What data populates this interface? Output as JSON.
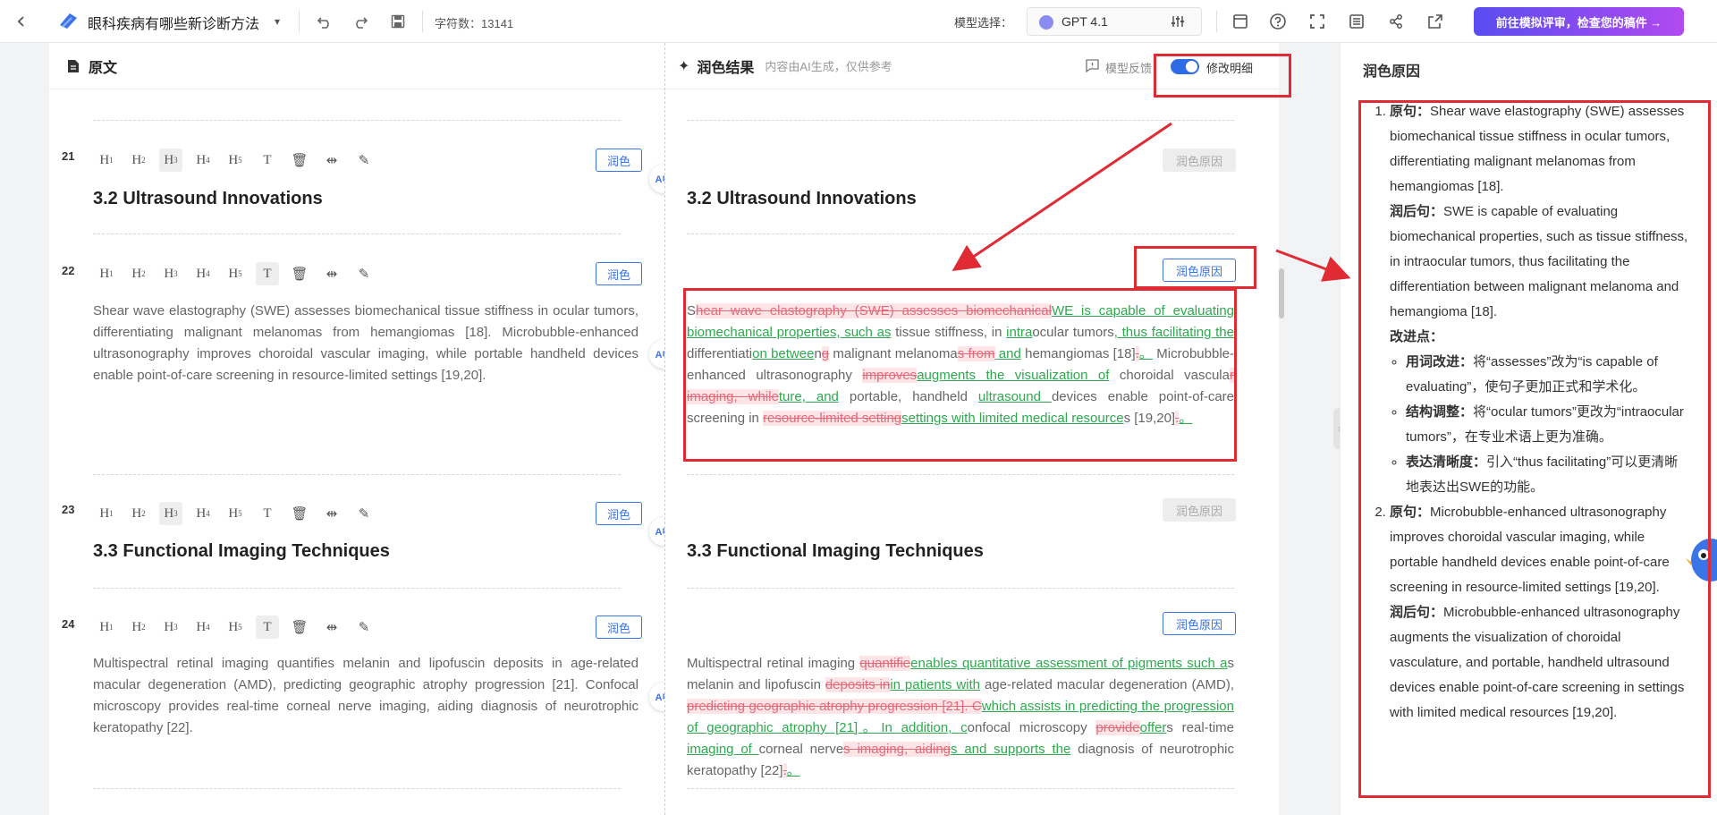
{
  "topbar": {
    "doc_title": "眼科疾病有哪些新诊断方法",
    "char_count": "字符数：13141",
    "model_label": "模型选择：",
    "model_name": "GPT 4.1",
    "cta": "前往模拟评审，检查您的稿件 →"
  },
  "left": {
    "header": "原文"
  },
  "right": {
    "header": "润色结果",
    "subheader": "内容由AI生成，仅供参考",
    "feedback": "模型反馈",
    "toggle_label": "修改明细"
  },
  "buttons": {
    "polish": "润色",
    "reason": "润色原因"
  },
  "sections": {
    "r21": {
      "num": "21",
      "title": "3.2 Ultrasound Innovations"
    },
    "r22": {
      "num": "22",
      "orig": "Shear wave elastography (SWE) assesses biomechanical tissue stiffness in ocular tumors, differentiating malignant melanomas from hemangiomas [18]. Microbubble-enhanced ultrasonography improves choroidal vascular imaging, while portable handheld devices enable point-of-care screening in resource-limited settings [19,20]."
    },
    "r23": {
      "num": "23",
      "title": "3.3 Functional Imaging Techniques"
    },
    "r24": {
      "num": "24",
      "orig": "Multispectral retinal imaging quantifies melanin and lipofuscin deposits in age-related macular degeneration (AMD), predicting geographic atrophy progression [21]. Confocal microscopy provides real-time corneal nerve imaging, aiding diagnosis of neurotrophic keratopathy [22]."
    }
  },
  "diff22": [
    [
      "n",
      "S"
    ],
    [
      "d",
      "hear wave elastography (SWE) assesses biomechanical"
    ],
    [
      "i",
      "WE is capable of evaluating biomechanical properties, such as"
    ],
    [
      "n",
      " tissue stiffness, in "
    ],
    [
      "i",
      "intra"
    ],
    [
      "n",
      "ocular tumors"
    ],
    [
      "i",
      ", thus facilitating the"
    ],
    [
      "n",
      " differentiati"
    ],
    [
      "i",
      "on betwee"
    ],
    [
      "n",
      "n"
    ],
    [
      "d",
      "g"
    ],
    [
      "n",
      " malignant melanoma"
    ],
    [
      "d",
      "s from"
    ],
    [
      "i",
      " and"
    ],
    [
      "n",
      " hemangiomas [18]"
    ],
    [
      "d",
      "."
    ],
    [
      "i",
      "。"
    ],
    [
      "n",
      " Microbubble-enhanced ultrasonography "
    ],
    [
      "d",
      "improves"
    ],
    [
      "i",
      "augments the visualization of"
    ],
    [
      "n",
      " choroidal vascula"
    ],
    [
      "d",
      "r imaging, while"
    ],
    [
      "i",
      "ture, and"
    ],
    [
      "n",
      " portable, handheld "
    ],
    [
      "i",
      "ultrasound "
    ],
    [
      "n",
      "devices enable point-of-care screening in "
    ],
    [
      "d",
      "resource-limited setting"
    ],
    [
      "i",
      "settings with limited medical resource"
    ],
    [
      "n",
      "s [19,20]"
    ],
    [
      "d",
      "."
    ],
    [
      "i",
      "。"
    ]
  ],
  "diff24": [
    [
      "n",
      "Multispectral retinal imaging "
    ],
    [
      "d",
      "quantifie"
    ],
    [
      "i",
      "enables quantitative assessment of pigments such a"
    ],
    [
      "n",
      "s melanin and lipofuscin "
    ],
    [
      "d",
      "deposits in"
    ],
    [
      "i",
      "in patients with"
    ],
    [
      "n",
      " age-related macular degeneration (AMD), "
    ],
    [
      "d",
      "predicting geographic atrophy progression [21]. C"
    ],
    [
      "i",
      "which assists in predicting the progression of geographic atrophy [21]。In addition, c"
    ],
    [
      "n",
      "onfocal microscopy "
    ],
    [
      "d",
      "provide"
    ],
    [
      "i",
      "offer"
    ],
    [
      "n",
      "s real-time "
    ],
    [
      "i",
      "imaging of "
    ],
    [
      "n",
      "corneal nerve"
    ],
    [
      "d",
      "s imaging, aiding"
    ],
    [
      "i",
      "s and supports the"
    ],
    [
      "n",
      " diagnosis of neurotrophic keratopathy [22]"
    ],
    [
      "d",
      "."
    ],
    [
      "i",
      "。"
    ]
  ],
  "sidepanel": {
    "title": "润色原因",
    "items": [
      {
        "orig_label": "原句：",
        "orig": "Shear wave elastography (SWE) assesses biomechanical tissue stiffness in ocular tumors, differentiating malignant melanomas from hemangiomas [18].",
        "new_label": "润后句：",
        "new": "SWE is capable of evaluating biomechanical properties, such as tissue stiffness, in intraocular tumors, thus facilitating the differentiation between malignant melanoma and hemangioma [18].",
        "points_label": "改进点：",
        "points": [
          {
            "k": "用词改进：",
            "v": "将“assesses”改为“is capable of evaluating”，使句子更加正式和学术化。"
          },
          {
            "k": "结构调整：",
            "v": "将“ocular tumors”更改为“intraocular tumors”，在专业术语上更为准确。"
          },
          {
            "k": "表达清晰度：",
            "v": "引入“thus facilitating”可以更清晰地表达出SWE的功能。"
          }
        ]
      },
      {
        "orig_label": "原句：",
        "orig": "Microbubble-enhanced ultrasonography improves choroidal vascular imaging, while portable handheld devices enable point-of-care screening in resource-limited settings [19,20].",
        "new_label": "润后句：",
        "new": "Microbubble-enhanced ultrasonography augments the visualization of choroidal vasculature, and portable, handheld ultrasound devices enable point-of-care screening in settings with limited medical resources [19,20].",
        "points_label": "",
        "points": []
      }
    ]
  }
}
